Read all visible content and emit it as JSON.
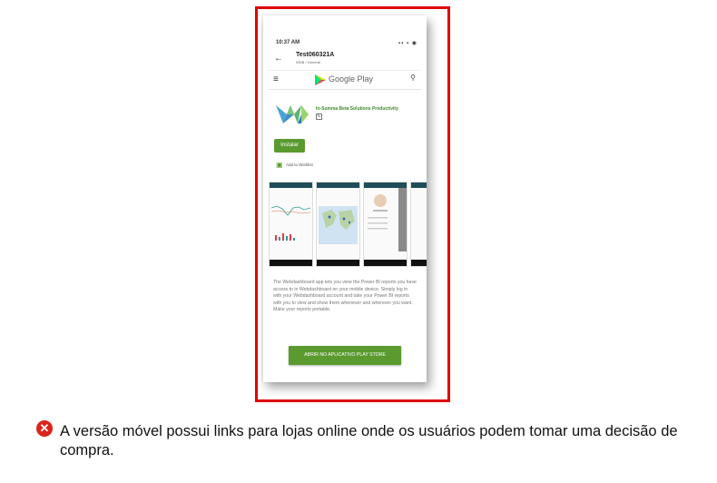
{
  "phone": {
    "status_time": "10:37 AM",
    "status_icons": "▪▪ ▪ ◉",
    "back_glyph": "←",
    "app_title": "Test060321A",
    "app_subtitle": "WDB / General",
    "store_name": "Google Play",
    "menu_glyph": "≡",
    "search_glyph": "⚲",
    "developer": "In-Summa Beta Solutions   Productivity",
    "rating_badge": "E",
    "install_label": "Instalar",
    "wishlist_icon": "▣",
    "wishlist_label": "Add to Wishlist",
    "description": "The Webdashboard app lets you view the Power BI reports you have access to in Webdashboard on your mobile device. Simply log in with your Webdashboard account and take your Power BI reports with you to view and show them whenever and wherever you want. Make your reports portable.",
    "open_button": "ABRIR NO APLICATIVO PLAY STORE"
  },
  "caption": {
    "icon": "x-circle-icon",
    "icon_glyph": "✕",
    "text": "A versão móvel possui links para lojas online onde os usuários podem tomar uma decisão de compra."
  },
  "colors": {
    "frame": "#e00000",
    "green": "#5a9a2e",
    "error": "#d9241b"
  }
}
